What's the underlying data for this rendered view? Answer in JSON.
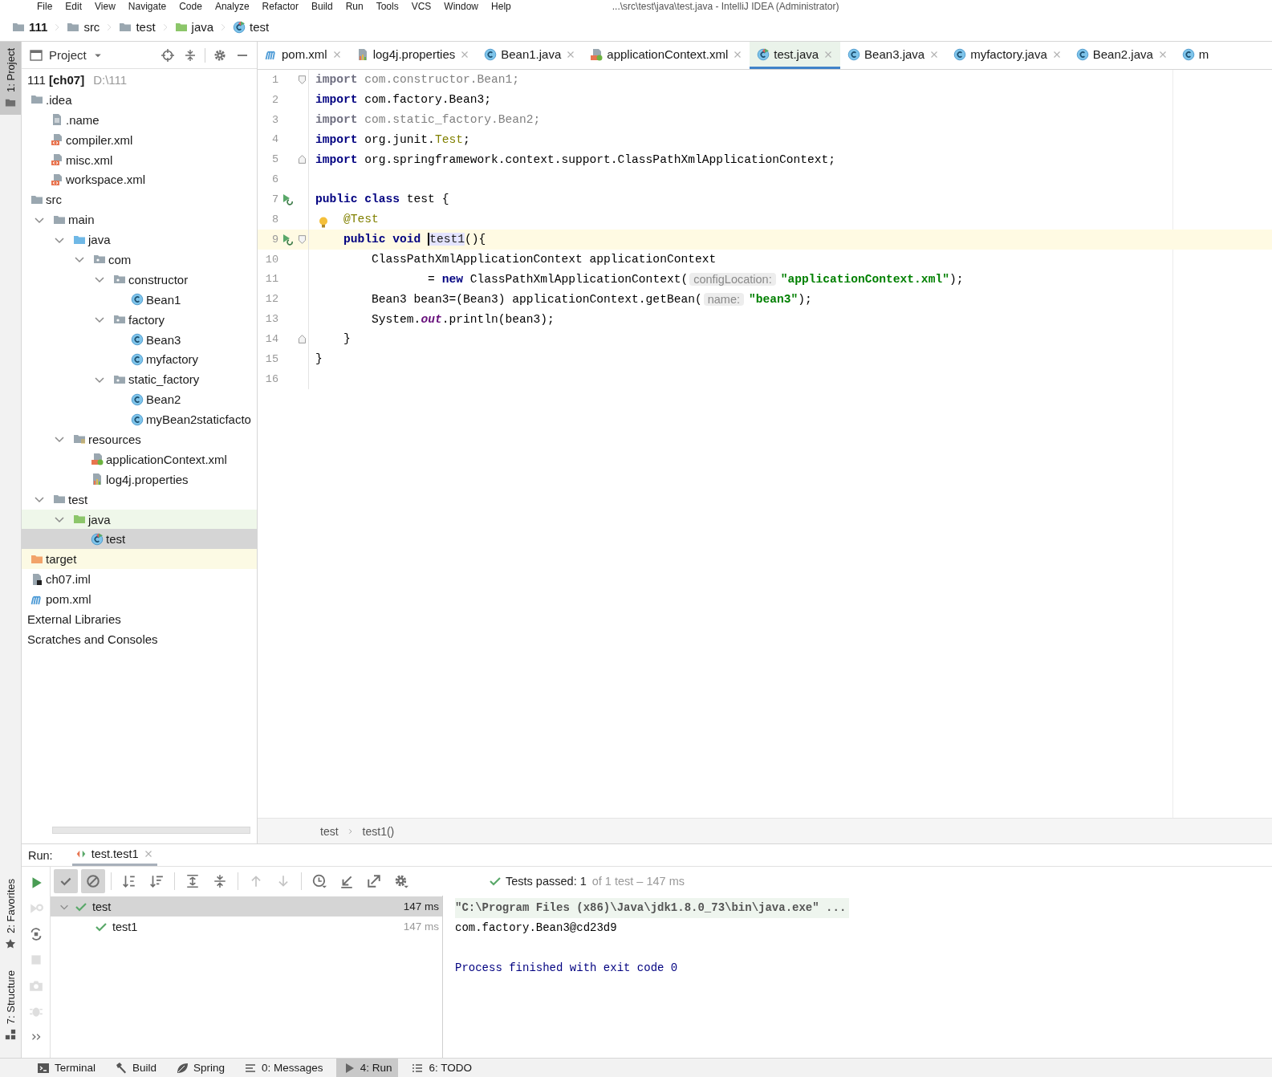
{
  "menu_bar": {
    "items": [
      "File",
      "Edit",
      "View",
      "Navigate",
      "Code",
      "Analyze",
      "Refactor",
      "Build",
      "Run",
      "Tools",
      "VCS",
      "Window",
      "Help"
    ],
    "title": "...\\src\\test\\java\\test.java - IntelliJ IDEA (Administrator)"
  },
  "breadcrumbs": [
    {
      "label": "111",
      "kind": "module"
    },
    {
      "label": "src",
      "kind": "folder"
    },
    {
      "label": "test",
      "kind": "folder"
    },
    {
      "label": "java",
      "kind": "test-folder"
    },
    {
      "label": "test",
      "kind": "test-class"
    }
  ],
  "left_stripe": [
    {
      "label": "1: Project",
      "kind": "project",
      "selected": true
    },
    {
      "label": "2: Favorites",
      "kind": "favorites",
      "selected": false
    },
    {
      "label": "7: Structure",
      "kind": "structure",
      "selected": false
    }
  ],
  "project_panel": {
    "title": "Project",
    "tree": [
      {
        "label": "111 **[ch07]**",
        "location": "D:\\111",
        "selected": false,
        "children": [
          {
            "label": ".idea",
            "kind": "folder",
            "selected": false,
            "children": [
              {
                "label": ".name",
                "kind": "text",
                "selected": false
              },
              {
                "label": "compiler.xml",
                "kind": "xml",
                "selected": false
              },
              {
                "label": "misc.xml",
                "kind": "xml",
                "selected": false
              },
              {
                "label": "workspace.xml",
                "kind": "xml",
                "selected": false
              }
            ]
          },
          {
            "label": "src",
            "kind": "folder",
            "selected": false,
            "children": [
              {
                "label": "main",
                "kind": "folder",
                "expanded": true,
                "selected": false,
                "children": [
                  {
                    "label": "java",
                    "kind": "source-folder",
                    "expanded": true,
                    "selected": false,
                    "children": [
                      {
                        "label": "com",
                        "kind": "package",
                        "expanded": true,
                        "selected": false,
                        "children": [
                          {
                            "label": "constructor",
                            "kind": "package",
                            "expanded": true,
                            "selected": false,
                            "children": [
                              {
                                "label": "Bean1",
                                "kind": "class",
                                "selected": false
                              }
                            ]
                          },
                          {
                            "label": "factory",
                            "kind": "package",
                            "expanded": true,
                            "selected": false,
                            "children": [
                              {
                                "label": "Bean3",
                                "kind": "class",
                                "selected": false
                              },
                              {
                                "label": "myfactory",
                                "kind": "class",
                                "selected": false
                              }
                            ]
                          },
                          {
                            "label": "static_factory",
                            "kind": "package",
                            "expanded": true,
                            "selected": false,
                            "children": [
                              {
                                "label": "Bean2",
                                "kind": "class",
                                "selected": false
                              },
                              {
                                "label": "myBean2staticfacto",
                                "kind": "class",
                                "selected": false
                              }
                            ]
                          }
                        ]
                      }
                    ]
                  },
                  {
                    "label": "resources",
                    "kind": "resources",
                    "expanded": true,
                    "selected": false,
                    "children": [
                      {
                        "label": "applicationContext.xml",
                        "kind": "spring-xml",
                        "selected": false
                      },
                      {
                        "label": "log4j.properties",
                        "kind": "properties",
                        "selected": false
                      }
                    ]
                  }
                ]
              },
              {
                "label": "test",
                "kind": "folder",
                "expanded": true,
                "selected": false,
                "children": [
                  {
                    "label": "java",
                    "kind": "test-folder",
                    "expanded": true,
                    "selected": false,
                    "color": "#eff7ea",
                    "children": [
                      {
                        "label": "test",
                        "kind": "test-class",
                        "selected": true
                      }
                    ]
                  }
                ]
              }
            ]
          },
          {
            "label": "target",
            "kind": "excluded-folder",
            "selected": false,
            "color": "#fcfae4"
          },
          {
            "label": "ch07.iml",
            "kind": "iml",
            "selected": false
          },
          {
            "label": "pom.xml",
            "kind": "maven",
            "selected": false
          }
        ]
      },
      {
        "label": "External Libraries",
        "selected": false
      },
      {
        "label": "Scratches and Consoles",
        "selected": false
      }
    ]
  },
  "editor": {
    "tabs": [
      {
        "label": "pom.xml",
        "kind": "maven",
        "selected": false,
        "closable": true
      },
      {
        "label": "log4j.properties",
        "kind": "properties",
        "selected": false,
        "closable": true
      },
      {
        "label": "Bean1.java",
        "kind": "class",
        "selected": false,
        "closable": true
      },
      {
        "label": "applicationContext.xml",
        "kind": "spring-xml",
        "selected": false,
        "closable": true
      },
      {
        "label": "test.java",
        "kind": "test-class",
        "selected": true,
        "closable": true
      },
      {
        "label": "Bean3.java",
        "kind": "class",
        "selected": false,
        "closable": true
      },
      {
        "label": "myfactory.java",
        "kind": "class",
        "selected": false,
        "closable": true
      },
      {
        "label": "Bean2.java",
        "kind": "class",
        "selected": false,
        "closable": true
      },
      {
        "label": "m",
        "kind": "class",
        "selected": false,
        "closable": false
      }
    ],
    "lines": [
      {
        "number": "1",
        "current": false,
        "run_marker": false,
        "bulb": false,
        "fold_start": true,
        "fold_end": false,
        "tokens": [
          {
            "kind": "unused-kw",
            "text": "import"
          },
          {
            "kind": "unused",
            "text": " com.constructor.Bean1;"
          }
        ]
      },
      {
        "number": "2",
        "current": false,
        "run_marker": false,
        "bulb": false,
        "fold_start": false,
        "fold_end": false,
        "tokens": [
          {
            "kind": "kw",
            "text": "import"
          },
          {
            "kind": "plain",
            "text": " com.factory.Bean3;"
          }
        ]
      },
      {
        "number": "3",
        "current": false,
        "run_marker": false,
        "bulb": false,
        "fold_start": false,
        "fold_end": false,
        "tokens": [
          {
            "kind": "unused-kw",
            "text": "import"
          },
          {
            "kind": "unused",
            "text": " com.static_factory.Bean2;"
          }
        ]
      },
      {
        "number": "4",
        "current": false,
        "run_marker": false,
        "bulb": false,
        "fold_start": false,
        "fold_end": false,
        "tokens": [
          {
            "kind": "kw",
            "text": "import"
          },
          {
            "kind": "plain",
            "text": " org.junit."
          },
          {
            "kind": "ann",
            "text": "Test"
          },
          {
            "kind": "plain",
            "text": ";"
          }
        ]
      },
      {
        "number": "5",
        "current": false,
        "run_marker": false,
        "bulb": false,
        "fold_start": false,
        "fold_end": true,
        "tokens": [
          {
            "kind": "kw",
            "text": "import"
          },
          {
            "kind": "plain",
            "text": " org.springframework.context.support.ClassPathXmlApplicationContext;"
          }
        ]
      },
      {
        "number": "6",
        "current": false,
        "run_marker": false,
        "bulb": false,
        "fold_start": false,
        "fold_end": false
      },
      {
        "number": "7",
        "current": false,
        "run_marker": true,
        "bulb": false,
        "fold_start": false,
        "fold_end": false,
        "tokens": [
          {
            "kind": "kw",
            "text": "public class"
          },
          {
            "kind": "plain",
            "text": " test {"
          }
        ]
      },
      {
        "number": "8",
        "current": false,
        "run_marker": false,
        "bulb": true,
        "fold_start": false,
        "fold_end": false,
        "tokens": [
          {
            "kind": "ann",
            "text": "    @Test"
          }
        ]
      },
      {
        "number": "9",
        "current": true,
        "run_marker": true,
        "bulb": false,
        "fold_start": true,
        "fold_end": false,
        "tokens": [
          {
            "kind": "kw",
            "text": "    public void "
          },
          {
            "kind": "caret",
            "text": "test1"
          },
          {
            "kind": "plain",
            "text": "(){"
          }
        ]
      },
      {
        "number": "10",
        "current": false,
        "run_marker": false,
        "bulb": false,
        "fold_start": false,
        "fold_end": false,
        "tokens": [
          {
            "kind": "plain",
            "text": "        ClassPathXmlApplicationContext applicationContext"
          }
        ]
      },
      {
        "number": "11",
        "current": false,
        "run_marker": false,
        "bulb": false,
        "fold_start": false,
        "fold_end": false,
        "tokens": [
          {
            "kind": "plain",
            "text": "                = "
          },
          {
            "kind": "kw",
            "text": "new"
          },
          {
            "kind": "plain",
            "text": " ClassPathXmlApplicationContext("
          },
          {
            "kind": "hint",
            "text": "configLocation:"
          },
          {
            "kind": "str",
            "text": "\"applicationContext.xml\""
          },
          {
            "kind": "plain",
            "text": ");"
          }
        ]
      },
      {
        "number": "12",
        "current": false,
        "run_marker": false,
        "bulb": false,
        "fold_start": false,
        "fold_end": false,
        "tokens": [
          {
            "kind": "plain",
            "text": "        Bean3 bean3=(Bean3) applicationContext.getBean("
          },
          {
            "kind": "hint",
            "text": "name:"
          },
          {
            "kind": "str",
            "text": "\"bean3\""
          },
          {
            "kind": "plain",
            "text": ");"
          }
        ]
      },
      {
        "number": "13",
        "current": false,
        "run_marker": false,
        "bulb": false,
        "fold_start": false,
        "fold_end": false,
        "tokens": [
          {
            "kind": "plain",
            "text": "        System."
          },
          {
            "kind": "field",
            "text": "out"
          },
          {
            "kind": "plain",
            "text": ".println(bean3);"
          }
        ]
      },
      {
        "number": "14",
        "current": false,
        "run_marker": false,
        "bulb": false,
        "fold_start": false,
        "fold_end": true,
        "tokens": [
          {
            "kind": "plain",
            "text": "    }"
          }
        ]
      },
      {
        "number": "15",
        "current": false,
        "run_marker": false,
        "bulb": false,
        "fold_start": false,
        "fold_end": false,
        "tokens": [
          {
            "kind": "plain",
            "text": "}"
          }
        ]
      },
      {
        "number": "16",
        "current": false,
        "run_marker": false,
        "bulb": false,
        "fold_start": false,
        "fold_end": false
      }
    ],
    "breadcrumb": [
      "test",
      "test1()"
    ]
  },
  "run_panel": {
    "label": "Run:",
    "tab": "test.test1",
    "side_tools": [
      {
        "kind": "rerun",
        "disabled": false
      },
      {
        "kind": "rerun-failed",
        "disabled": true
      },
      {
        "kind": "auto-test",
        "disabled": false
      },
      {
        "kind": "stop",
        "disabled": true
      },
      {
        "kind": "camera",
        "disabled": true
      },
      {
        "kind": "debug",
        "disabled": true
      },
      {
        "kind": "more",
        "disabled": false
      }
    ],
    "toolbar": [
      {
        "kind": "check",
        "pressed": true
      },
      {
        "kind": "ignored",
        "pressed": true
      },
      {
        "kind": "sort-alpha",
        "pressed": false
      },
      {
        "kind": "sort-time",
        "pressed": false
      },
      {
        "kind": "expand",
        "pressed": false
      },
      {
        "kind": "collapse",
        "pressed": false
      },
      {
        "kind": "up",
        "pressed": false
      },
      {
        "kind": "down",
        "pressed": false
      },
      {
        "kind": "clock",
        "pressed": false
      },
      {
        "kind": "import",
        "pressed": false
      },
      {
        "kind": "export",
        "pressed": false
      },
      {
        "kind": "gear",
        "pressed": false
      }
    ],
    "status": "Tests passed: 1",
    "status_detail": "of 1 test – 147 ms",
    "tests": [
      {
        "label": "test",
        "time": "147 ms",
        "passed": true,
        "selected": true,
        "expanded": true,
        "children": [
          {
            "label": "test1",
            "time": "147 ms",
            "passed": true,
            "selected": false
          }
        ]
      }
    ],
    "console": [
      {
        "kind": "command",
        "text": "\"C:\\Program Files (x86)\\Java\\jdk1.8.0_73\\bin\\java.exe\" ..."
      },
      {
        "kind": "output",
        "text": "com.factory.Bean3@cd23d9"
      },
      {
        "kind": "blank"
      },
      {
        "kind": "system",
        "text": "Process finished with exit code 0"
      }
    ]
  },
  "tool_windows": [
    {
      "label": "Terminal",
      "kind": "terminal",
      "selected": false
    },
    {
      "label": "Build",
      "kind": "build",
      "selected": false
    },
    {
      "label": "Spring",
      "kind": "spring",
      "selected": false
    },
    {
      "label": "0: Messages",
      "kind": "messages",
      "selected": false
    },
    {
      "label": "4: Run",
      "kind": "run",
      "selected": true
    },
    {
      "label": "6: TODO",
      "kind": "todo",
      "selected": false
    }
  ]
}
